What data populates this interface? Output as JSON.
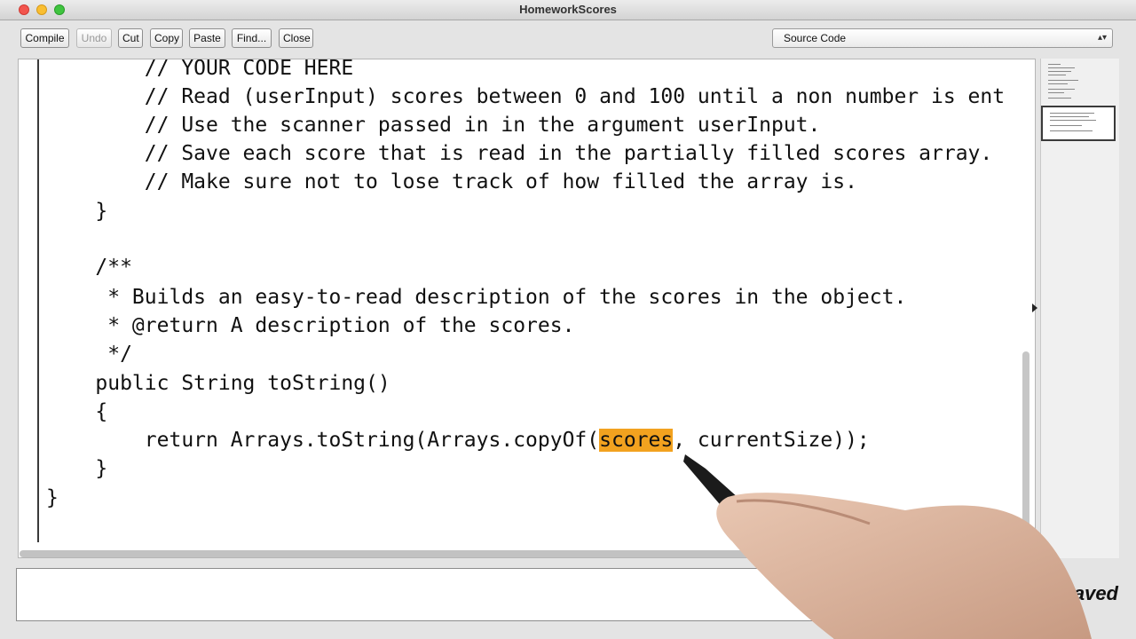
{
  "window": {
    "title": "HomeworkScores"
  },
  "toolbar": {
    "compile": "Compile",
    "undo": "Undo",
    "cut": "Cut",
    "copy": "Copy",
    "paste": "Paste",
    "find": "Find...",
    "close": "Close"
  },
  "view_select": {
    "value": "Source Code"
  },
  "editor": {
    "lines": [
      "        // YOUR CODE HERE",
      "        // Read (userInput) scores between 0 and 100 until a non number is ent",
      "        // Use the scanner passed in in the argument userInput.",
      "        // Save each score that is read in the partially filled scores array.",
      "        // Make sure not to lose track of how filled the array is.",
      "    }",
      "",
      "    /**",
      "     * Builds an easy-to-read description of the scores in the object.",
      "     * @return A description of the scores.",
      "     */",
      "    public String toString()",
      "    {",
      "        return Arrays.toString(Arrays.copyOf(",
      "    }",
      "}"
    ],
    "return_prefix": "        return Arrays.toString(Arrays.copyOf(",
    "highlighted": "scores",
    "return_suffix": ", currentSize));",
    "highlight_color": "#f2a21f"
  },
  "status": {
    "text": "saved"
  }
}
